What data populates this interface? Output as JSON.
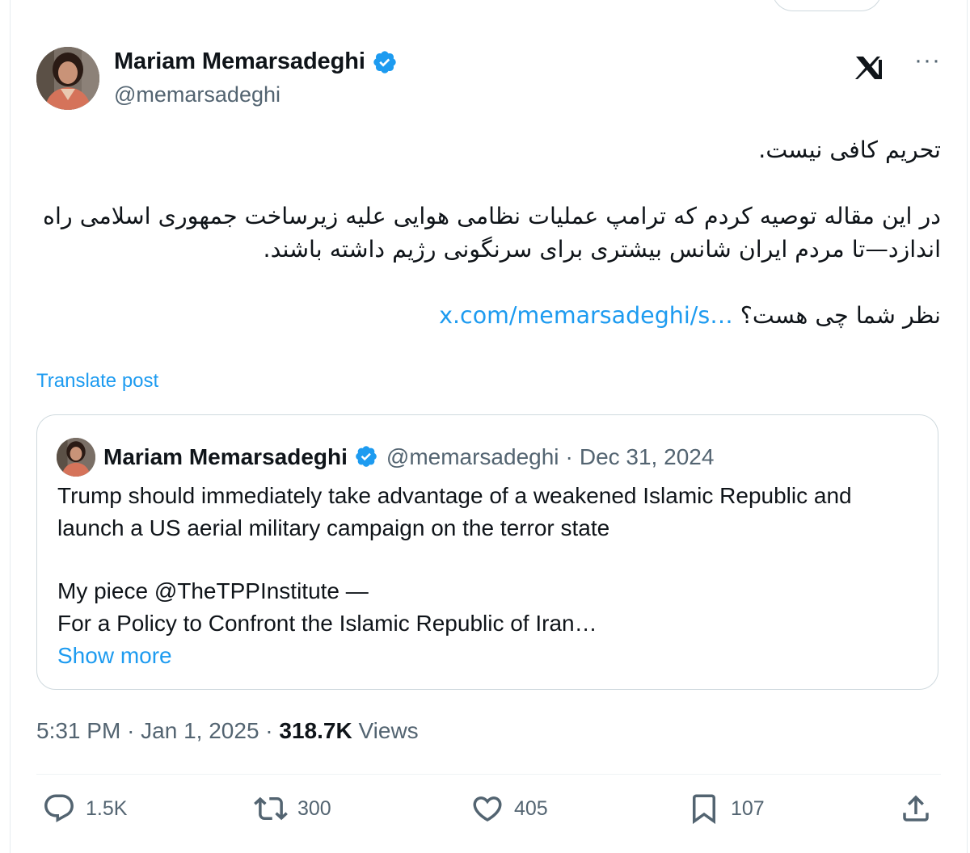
{
  "author": {
    "display_name": "Mariam Memarsadeghi",
    "handle": "@memarsadeghi"
  },
  "header_icons": {
    "logo": "x-logo-icon",
    "more": "···"
  },
  "tweet": {
    "line1": "تحریم کافی نیست.",
    "line2": "در این مقاله توصیه کردم که ترامپ عملیات نظامی هوایی علیه زیرساخت جمهوری اسلامی راه اندازد—تا مردم ایران شانس بیشتری برای سرنگونی رژیم داشته باشند.",
    "line3_text": "نظر شما چی هست؟",
    "line3_link": "x.com/memarsadeghi/s…",
    "translate": "Translate post"
  },
  "quote": {
    "display_name": "Mariam Memarsadeghi",
    "handle": "@memarsadeghi",
    "separator": "·",
    "date": "Dec 31, 2024",
    "para1": "Trump should immediately take advantage of a weakened Islamic Republic and launch a US aerial military campaign on the terror state",
    "line_a": "My piece @TheTPPInstitute —",
    "line_b": "For a Policy to Confront the Islamic Republic of Iran…",
    "show_more": "Show more"
  },
  "meta": {
    "time": "5:31 PM",
    "sep1": "·",
    "date": "Jan 1, 2025",
    "sep2": "·",
    "views_count": "318.7K",
    "views_label": "Views"
  },
  "actions": {
    "replies": "1.5K",
    "reposts": "300",
    "likes": "405",
    "bookmarks": "107"
  },
  "colors": {
    "accent": "#1d9bf0",
    "text": "#0f1419",
    "secondary": "#536471"
  }
}
